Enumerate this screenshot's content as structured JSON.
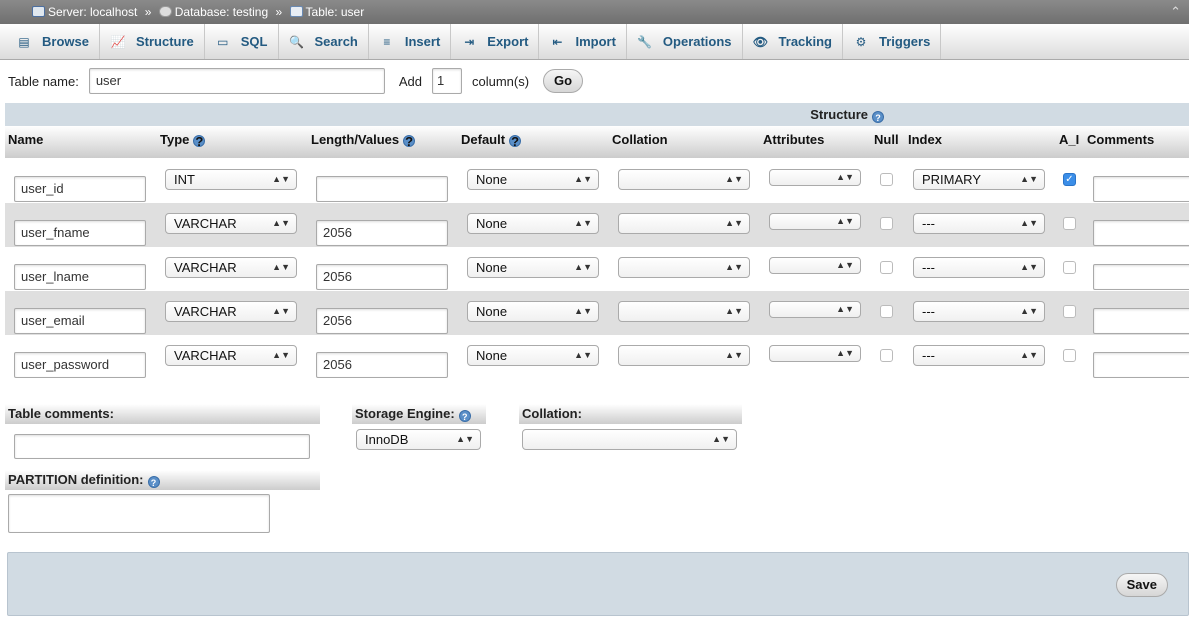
{
  "breadcrumb": {
    "server": "Server: localhost",
    "database": "Database: testing",
    "table": "Table: user",
    "sep": "»"
  },
  "tabs": [
    {
      "label": "Browse",
      "icon": "browse-icon"
    },
    {
      "label": "Structure",
      "icon": "structure-icon"
    },
    {
      "label": "SQL",
      "icon": "sql-icon"
    },
    {
      "label": "Search",
      "icon": "search-icon"
    },
    {
      "label": "Insert",
      "icon": "insert-icon"
    },
    {
      "label": "Export",
      "icon": "export-icon"
    },
    {
      "label": "Import",
      "icon": "import-icon"
    },
    {
      "label": "Operations",
      "icon": "operations-icon"
    },
    {
      "label": "Tracking",
      "icon": "tracking-icon"
    },
    {
      "label": "Triggers",
      "icon": "triggers-icon"
    }
  ],
  "tablename": {
    "label": "Table name:",
    "value": "user",
    "add_label": "Add",
    "add_count": "1",
    "columns_label": "column(s)",
    "go_label": "Go"
  },
  "structure_title": "Structure",
  "headers": {
    "name": "Name",
    "type": "Type",
    "length": "Length/Values",
    "default": "Default",
    "collation": "Collation",
    "attributes": "Attributes",
    "null": "Null",
    "index": "Index",
    "ai": "A_I",
    "comments": "Comments"
  },
  "rows": [
    {
      "name": "user_id",
      "type": "INT",
      "length": "",
      "default": "None",
      "collation": "",
      "attributes": "",
      "null": false,
      "index": "PRIMARY",
      "ai": true,
      "comments": ""
    },
    {
      "name": "user_fname",
      "type": "VARCHAR",
      "length": "2056",
      "default": "None",
      "collation": "",
      "attributes": "",
      "null": false,
      "index": "---",
      "ai": false,
      "comments": ""
    },
    {
      "name": "user_lname",
      "type": "VARCHAR",
      "length": "2056",
      "default": "None",
      "collation": "",
      "attributes": "",
      "null": false,
      "index": "---",
      "ai": false,
      "comments": ""
    },
    {
      "name": "user_email",
      "type": "VARCHAR",
      "length": "2056",
      "default": "None",
      "collation": "",
      "attributes": "",
      "null": false,
      "index": "---",
      "ai": false,
      "comments": ""
    },
    {
      "name": "user_password",
      "type": "VARCHAR",
      "length": "2056",
      "default": "None",
      "collation": "",
      "attributes": "",
      "null": false,
      "index": "---",
      "ai": false,
      "comments": ""
    }
  ],
  "table_comments_label": "Table comments:",
  "table_comments_value": "",
  "storage_engine_label": "Storage Engine:",
  "storage_engine_value": "InnoDB",
  "collation_label": "Collation:",
  "collation_value": "",
  "partition_label": "PARTITION definition:",
  "partition_value": "",
  "save_label": "Save",
  "collapse_glyph": "⌃"
}
